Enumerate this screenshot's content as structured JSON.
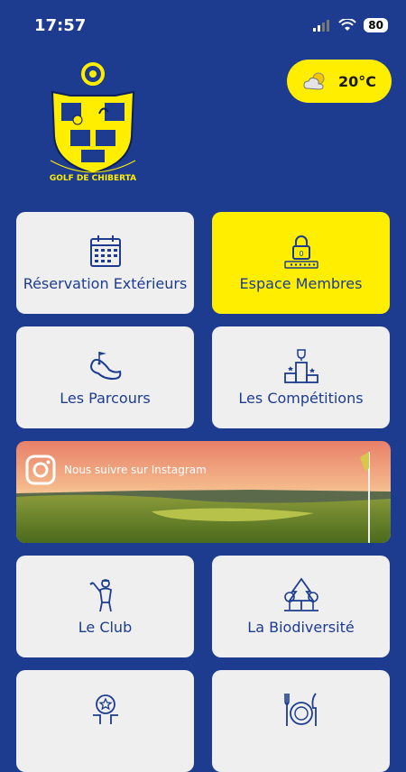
{
  "status_bar": {
    "time": "17:57",
    "battery": "80"
  },
  "weather": {
    "temperature": "20°C",
    "icon": "partly-cloudy-icon"
  },
  "crest": {
    "text": "GOLF DE CHIBERTA"
  },
  "tiles": [
    {
      "label": "Réservation Extérieurs",
      "icon": "calendar-icon"
    },
    {
      "label": "Espace Membres",
      "icon": "padlock-icon"
    },
    {
      "label": "Les Parcours",
      "icon": "golf-course-icon"
    },
    {
      "label": "Les Compétitions",
      "icon": "podium-icon"
    },
    {
      "label": "Le Club",
      "icon": "golfer-icon"
    },
    {
      "label": "La Biodiversité",
      "icon": "trees-icon"
    }
  ],
  "instagram": {
    "label": "Nous suivre sur Instagram"
  },
  "colors": {
    "background": "#1d3c8f",
    "accent": "#ffee00",
    "tile": "#efefef"
  }
}
